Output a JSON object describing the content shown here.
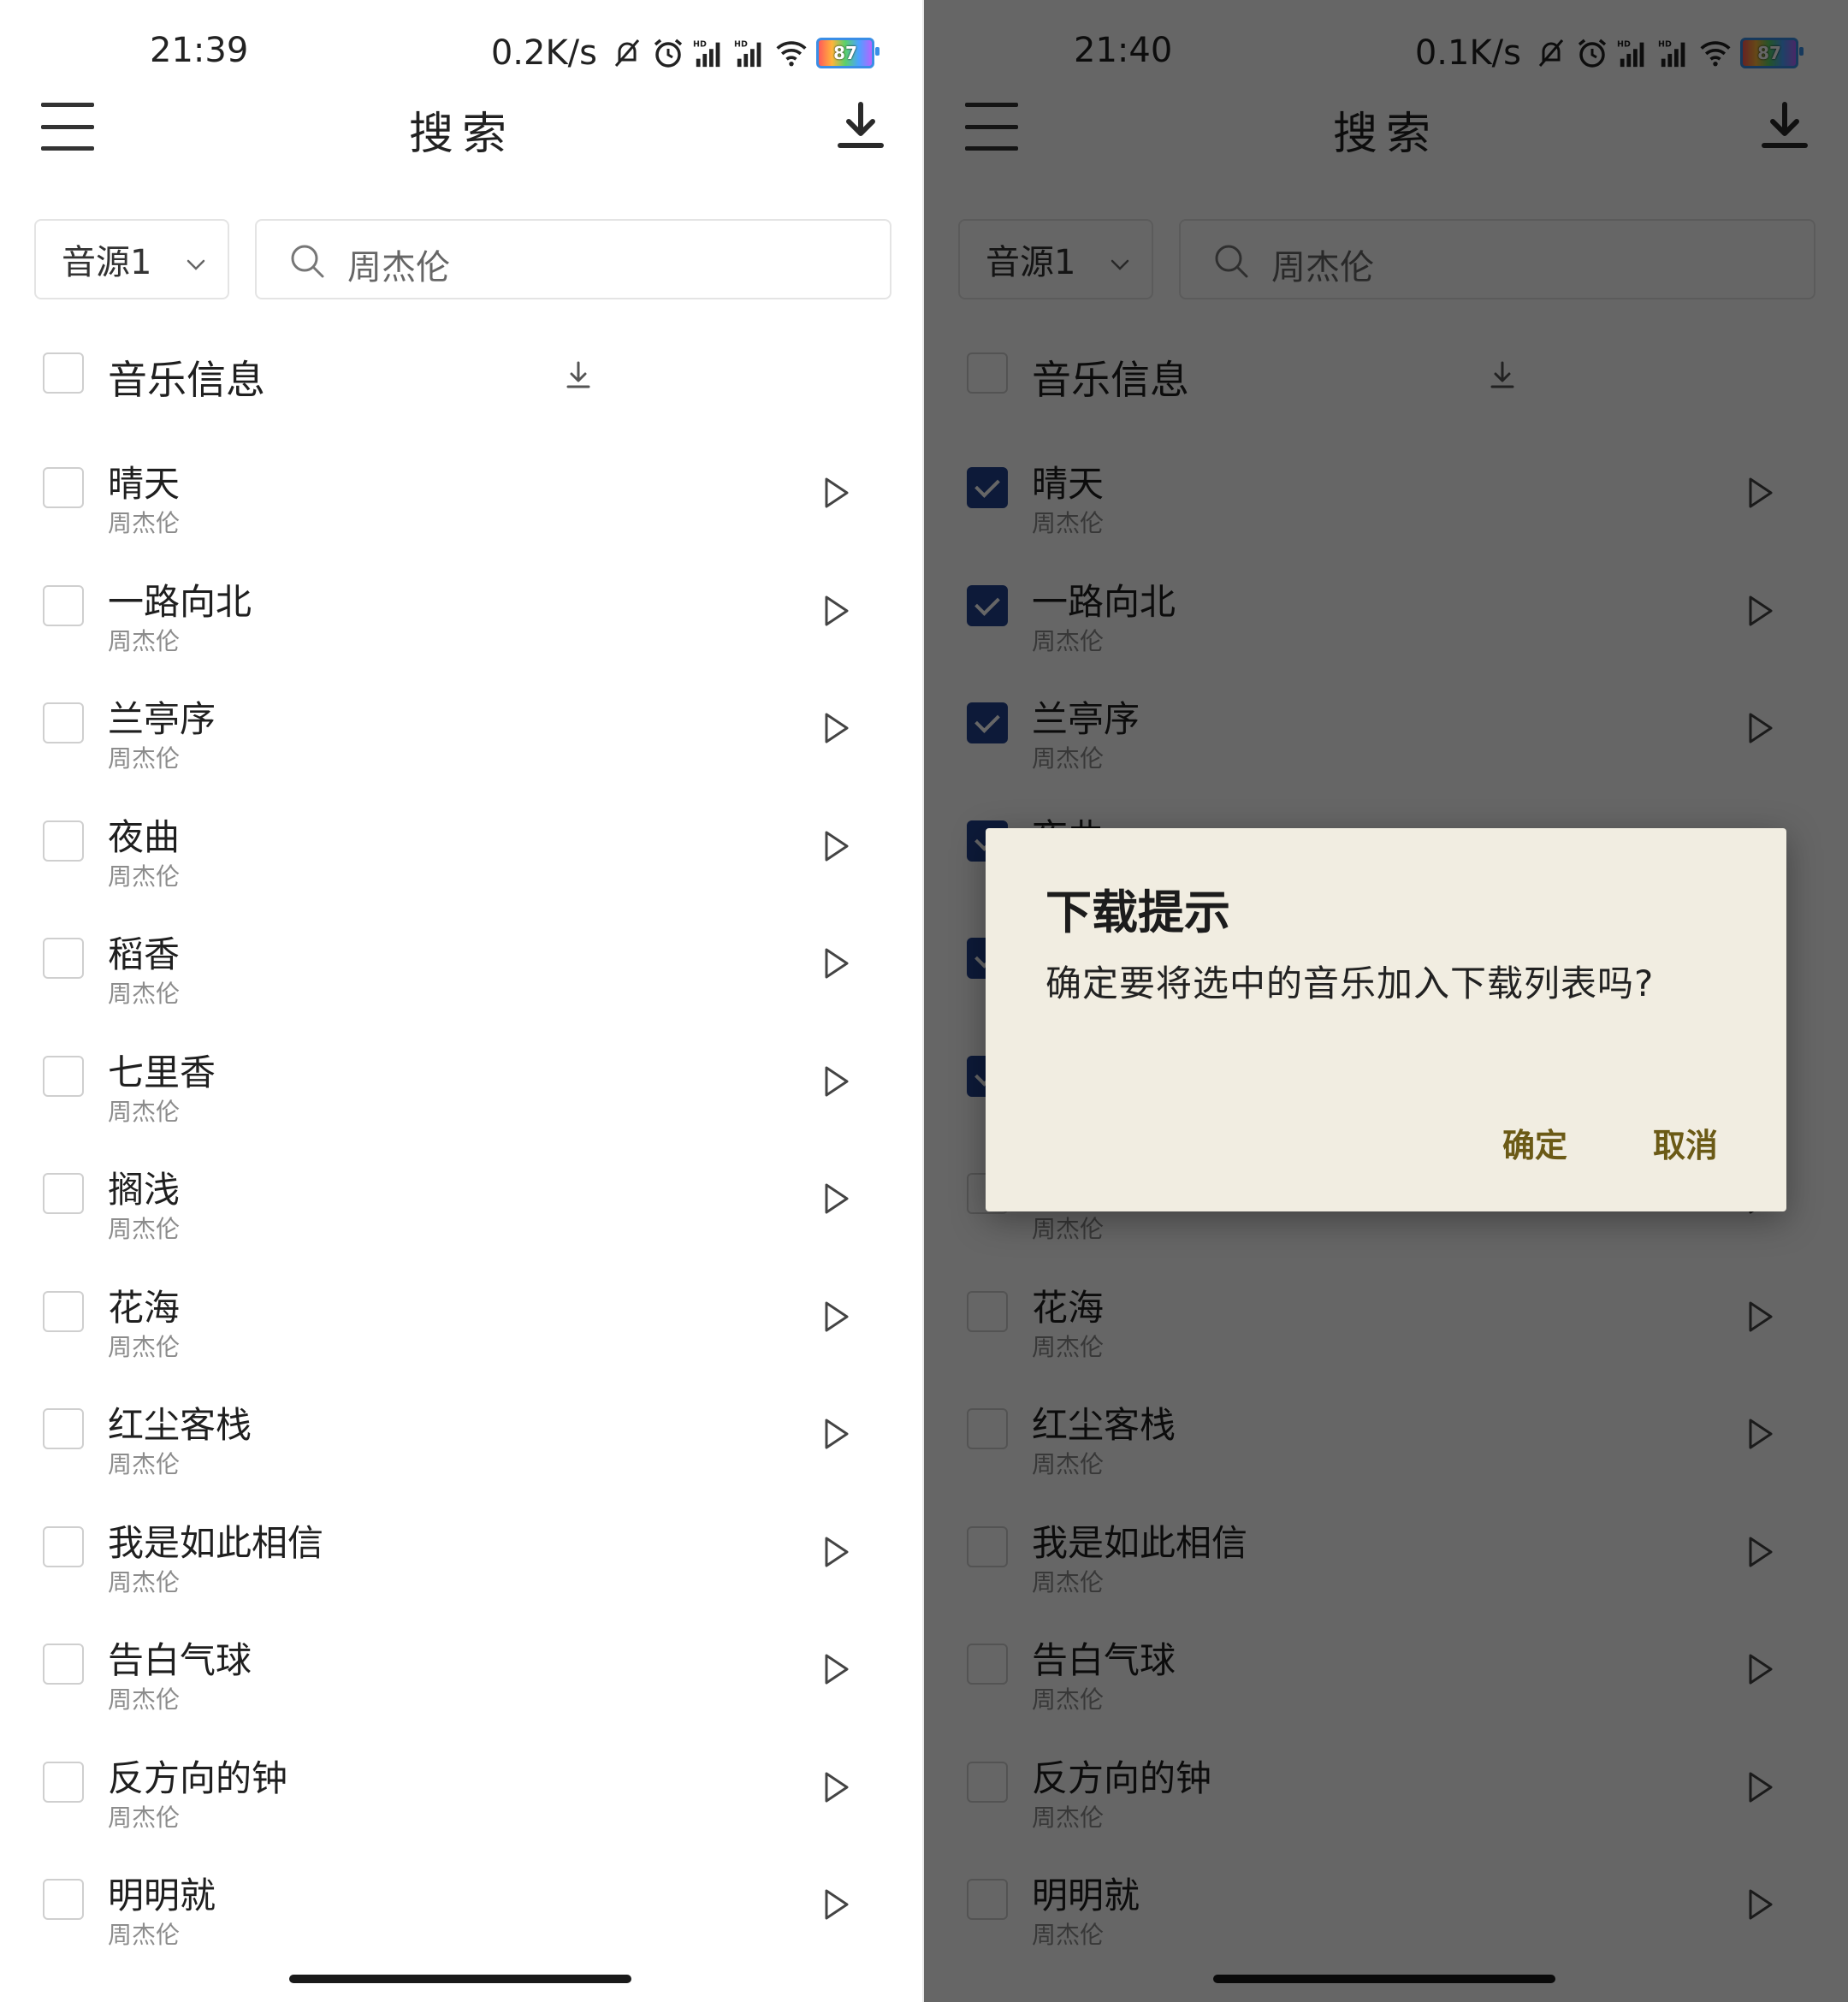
{
  "colors": {
    "accent": "#22418e",
    "dialog_bg": "#f1ede1",
    "dialog_button": "#6b5a16",
    "scrim": "rgba(0,0,0,0.6)"
  },
  "left": {
    "status": {
      "time": "21:39",
      "speed": "0.2K/s",
      "battery": "87"
    },
    "title": "搜索",
    "source": "音源1",
    "search_value": "周杰伦",
    "header_label": "音乐信息",
    "checked": [
      false,
      false,
      false,
      false,
      false,
      false,
      false,
      false,
      false,
      false,
      false,
      false,
      false
    ]
  },
  "right": {
    "status": {
      "time": "21:40",
      "speed": "0.1K/s",
      "battery": "87"
    },
    "title": "搜索",
    "source": "音源1",
    "search_value": "周杰伦",
    "header_label": "音乐信息",
    "checked": [
      true,
      true,
      true,
      true,
      true,
      true,
      false,
      false,
      false,
      false,
      false,
      false,
      false
    ],
    "dialog": {
      "title": "下载提示",
      "message": "确定要将选中的音乐加入下载列表吗?",
      "ok": "确定",
      "cancel": "取消"
    }
  },
  "songs": [
    {
      "title": "晴天",
      "artist": "周杰伦"
    },
    {
      "title": "一路向北",
      "artist": "周杰伦"
    },
    {
      "title": "兰亭序",
      "artist": "周杰伦"
    },
    {
      "title": "夜曲",
      "artist": "周杰伦"
    },
    {
      "title": "稻香",
      "artist": "周杰伦"
    },
    {
      "title": "七里香",
      "artist": "周杰伦"
    },
    {
      "title": "搁浅",
      "artist": "周杰伦"
    },
    {
      "title": "花海",
      "artist": "周杰伦"
    },
    {
      "title": "红尘客栈",
      "artist": "周杰伦"
    },
    {
      "title": "我是如此相信",
      "artist": "周杰伦"
    },
    {
      "title": "告白气球",
      "artist": "周杰伦"
    },
    {
      "title": "反方向的钟",
      "artist": "周杰伦"
    },
    {
      "title": "明明就",
      "artist": "周杰伦"
    }
  ],
  "icons": [
    "menu-icon",
    "download-icon",
    "chevron-down-icon",
    "search-icon",
    "play-icon",
    "mute-icon",
    "alarm-icon",
    "signal-icon",
    "wifi-icon",
    "battery-icon"
  ]
}
